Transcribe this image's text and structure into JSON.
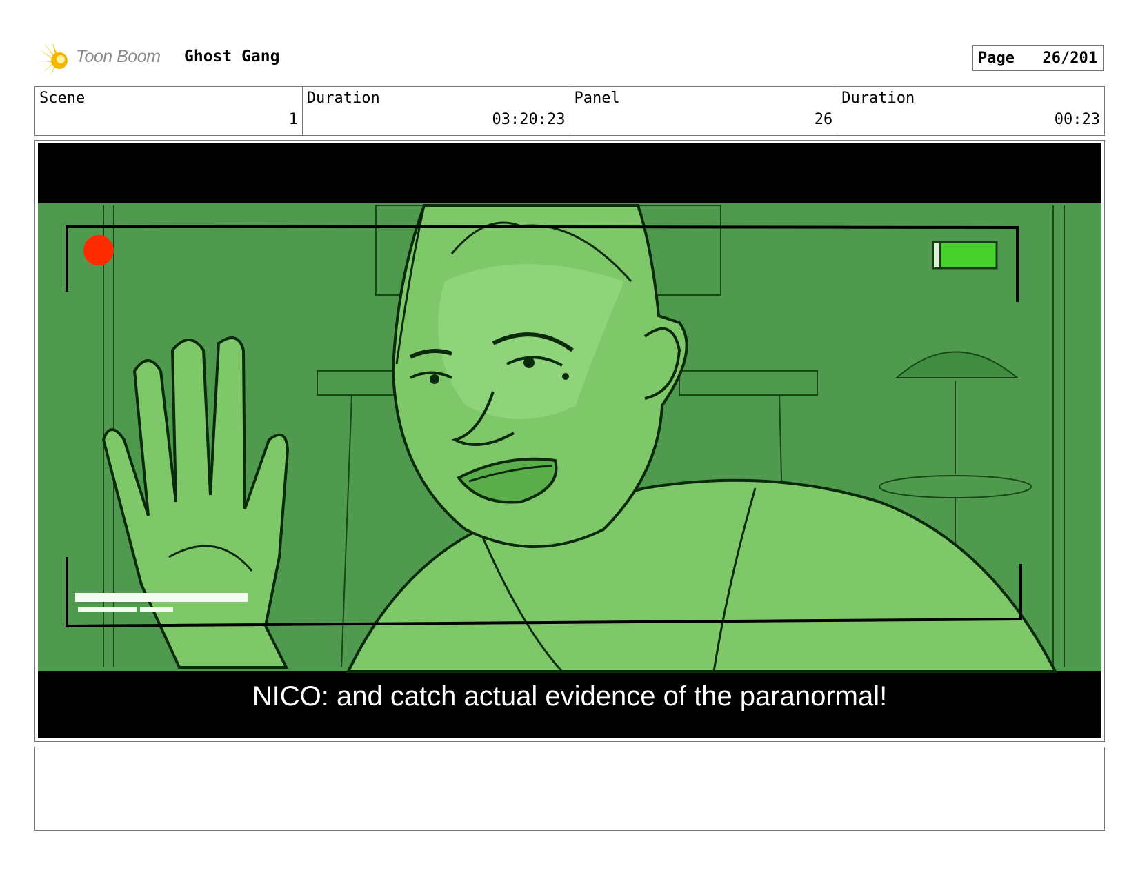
{
  "header": {
    "logo_text": "Toon Boom",
    "project_title": "Ghost Gang",
    "page_label": "Page",
    "page_value": "26/201"
  },
  "info": {
    "scene_label": "Scene",
    "scene_value": "1",
    "duration_label": "Duration",
    "duration_value": "03:20:23",
    "panel_label": "Panel",
    "panel_value": "26",
    "panel_duration_label": "Duration",
    "panel_duration_value": "00:23"
  },
  "panel": {
    "subtitle": "NICO: and catch actual evidence of the paranormal!",
    "colors": {
      "background_green": "#4f9a4f",
      "skin_green": "#7ec86a",
      "highlight_green": "#93d680",
      "line_dark": "#0b2a0b",
      "record_dot": "#ff2a00",
      "battery_green": "#46d12a",
      "letterbox": "#000000"
    },
    "icons": [
      "record-dot-icon",
      "battery-icon",
      "camera-frame-corners"
    ]
  },
  "notes": {
    "text": ""
  }
}
